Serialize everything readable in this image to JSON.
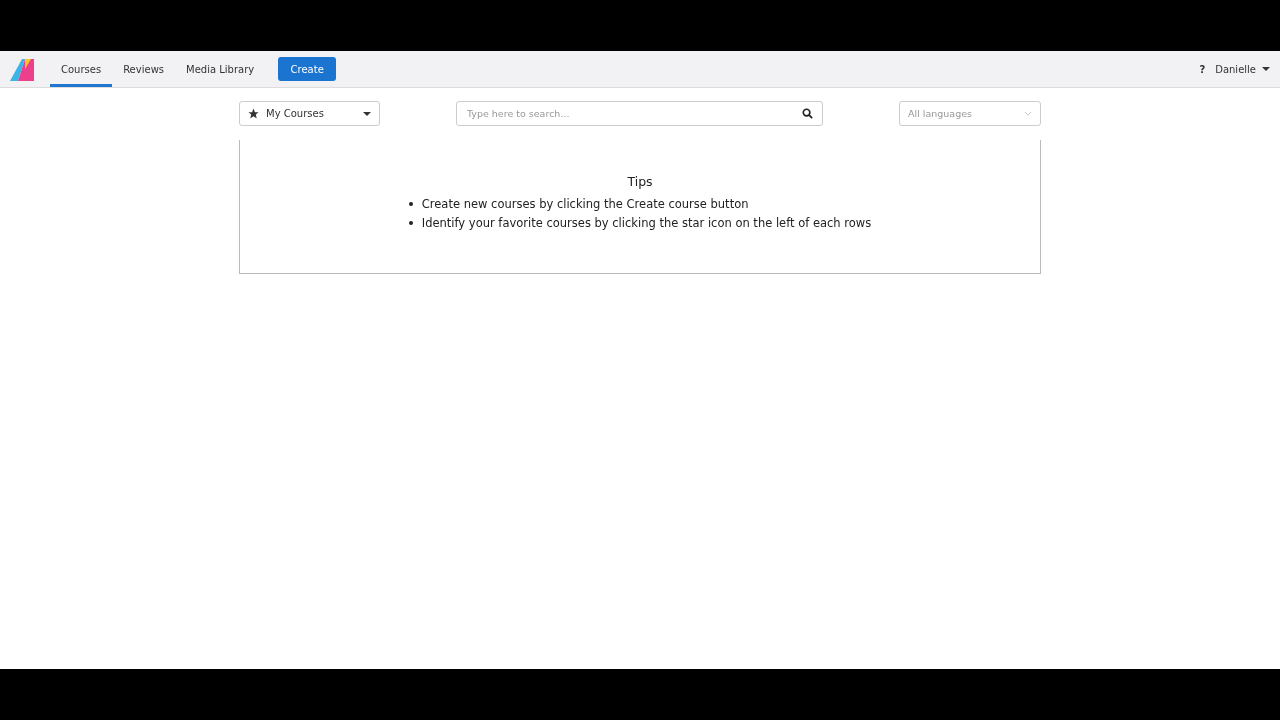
{
  "nav": {
    "tabs": [
      {
        "label": "Courses",
        "selected": true
      },
      {
        "label": "Reviews",
        "selected": false
      },
      {
        "label": "Media Library",
        "selected": false
      }
    ],
    "create_button": "Create",
    "help": "?",
    "user": "Danielle"
  },
  "filters": {
    "scope": "My Courses",
    "search": {
      "placeholder": "Type here to search..."
    },
    "language": {
      "placeholder": "All languages"
    }
  },
  "tips": {
    "title": "Tips",
    "items": [
      "Create new courses by clicking the Create course button",
      "Identify your favorite courses by clicking the star icon on the left of each rows"
    ]
  }
}
